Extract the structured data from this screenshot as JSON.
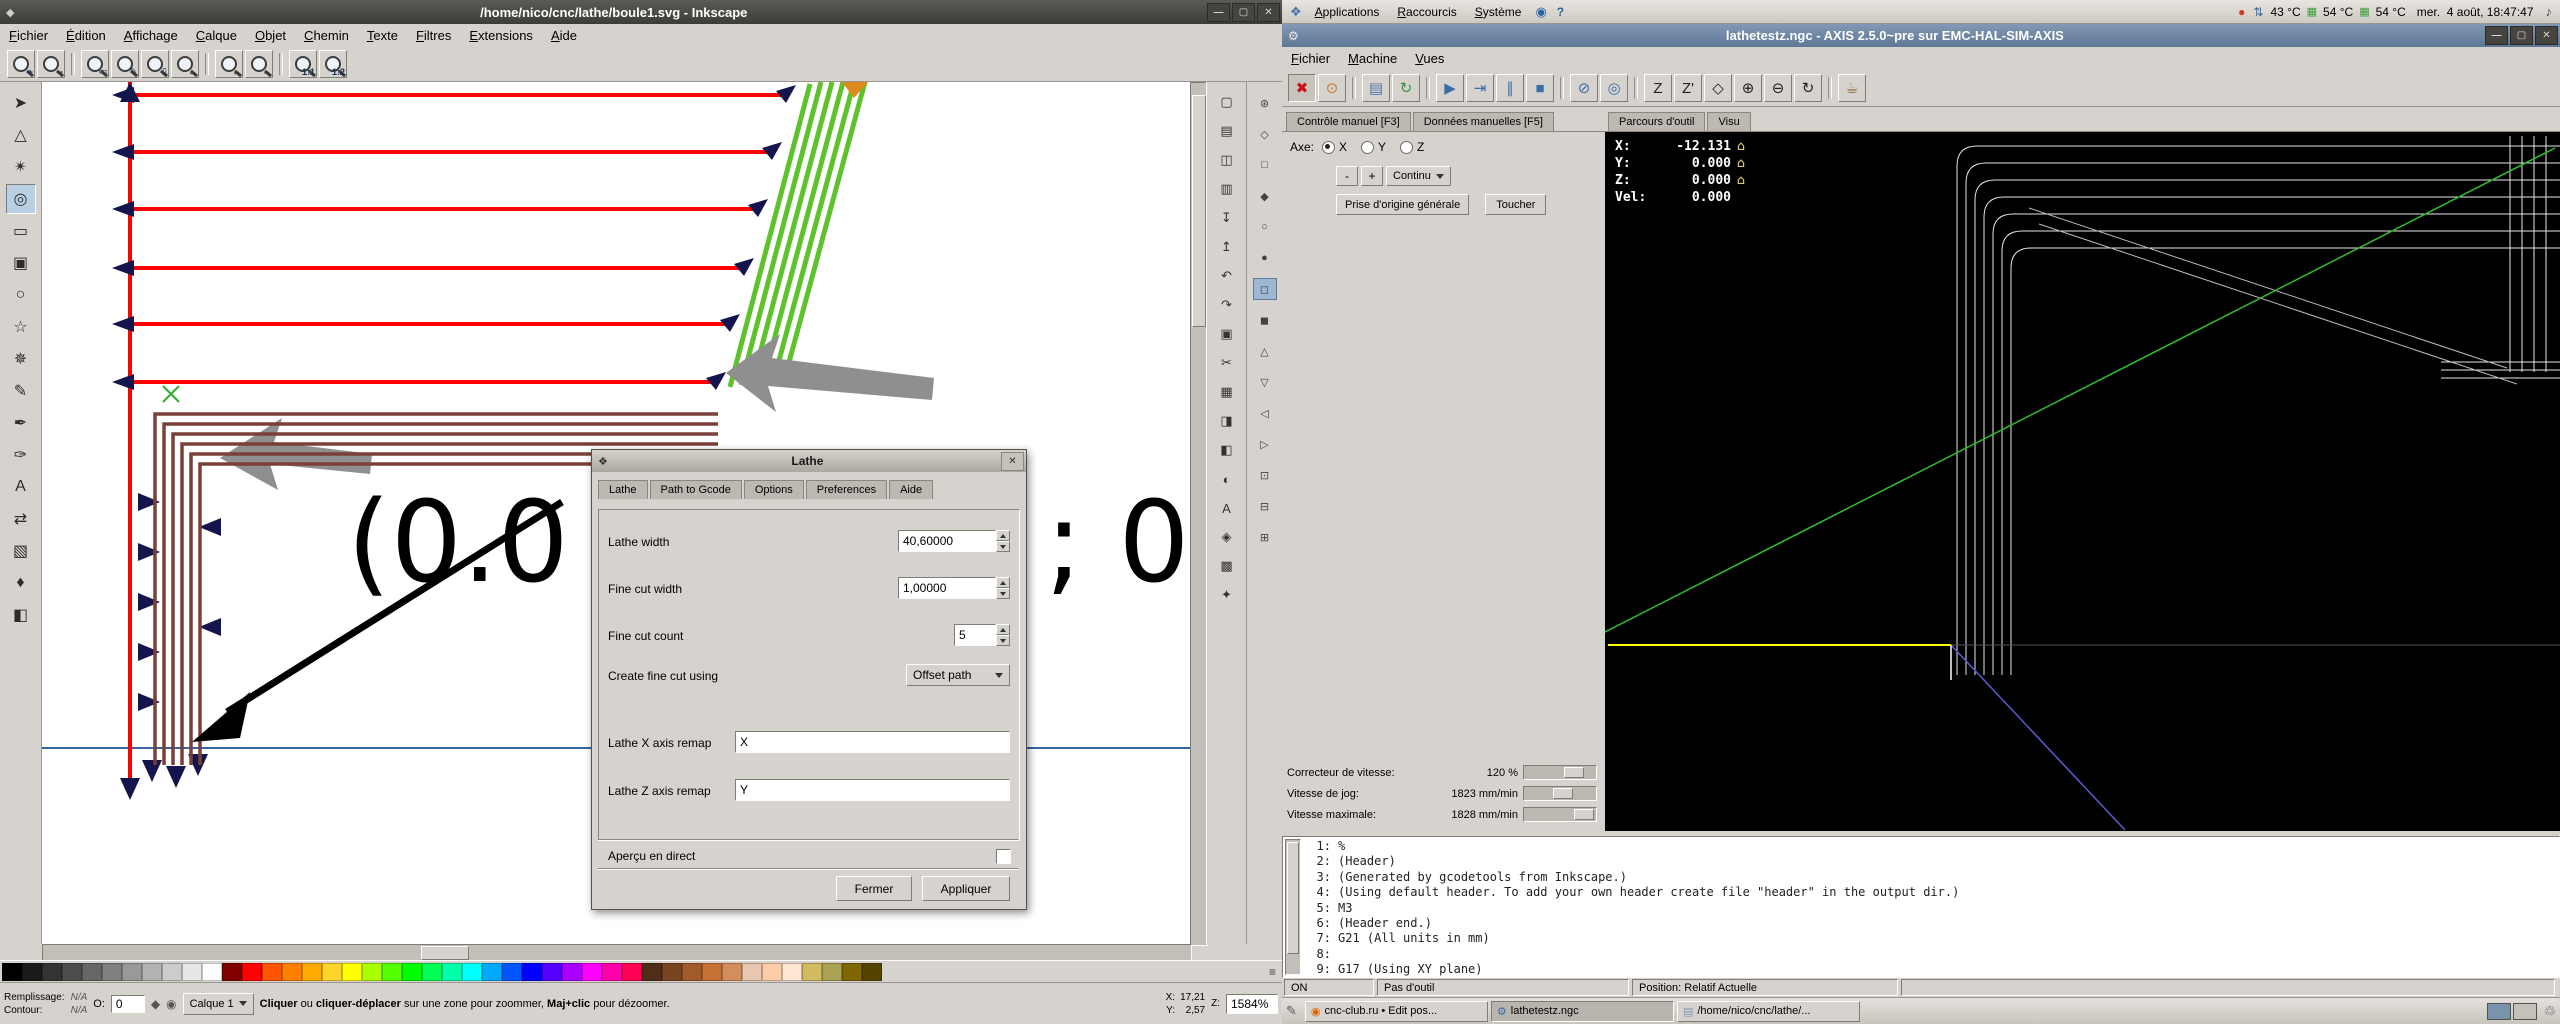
{
  "icons": {
    "app": "◆",
    "gear": "⚙",
    "dialog": "❖",
    "home": "⌂",
    "eye": "◉",
    "lock": "◆",
    "volume": "♪",
    "trash": "♲",
    "applet": "✎",
    "browser": "◉",
    "help": "?",
    "applications": "❖",
    "update": "●",
    "network": "⇅",
    "sensor": "▦",
    "min": "—",
    "max": "▢",
    "close": "✕",
    "palette_config": "≡"
  },
  "inkscape": {
    "window_title": "/home/nico/cnc/lathe/boule1.svg - Inkscape",
    "menus": [
      "Fichier",
      "Édition",
      "Affichage",
      "Calque",
      "Objet",
      "Chemin",
      "Texte",
      "Filtres",
      "Extensions",
      "Aide"
    ],
    "zoom_toolbar": {
      "g1": [
        {
          "name": "zoom-in-button",
          "sub": "+"
        },
        {
          "name": "zoom-out-button",
          "sub": "−"
        }
      ],
      "g2": [
        {
          "name": "zoom-selection-button",
          "sub": "▭"
        },
        {
          "name": "zoom-drawing-button",
          "sub": "✎"
        },
        {
          "name": "zoom-page-button",
          "sub": "▯"
        },
        {
          "name": "zoom-page-width-button",
          "sub": "↔"
        }
      ],
      "g3": [
        {
          "name": "zoom-previous-button",
          "sub": "←"
        },
        {
          "name": "zoom-next-button",
          "sub": "→"
        }
      ],
      "g4": [
        {
          "name": "zoom-1-1-button",
          "sub": "1:1"
        },
        {
          "name": "zoom-1-2-button",
          "sub": "1:2"
        }
      ]
    },
    "toolbox": [
      {
        "name": "selector-tool",
        "glyph": "➤"
      },
      {
        "name": "node-tool",
        "glyph": "△"
      },
      {
        "name": "tweak-tool",
        "glyph": "✴"
      },
      {
        "name": "zoom-tool",
        "glyph": "◎",
        "active": "true"
      },
      {
        "name": "rectangle-tool",
        "glyph": "▭"
      },
      {
        "name": "box-3d-tool",
        "glyph": "▣"
      },
      {
        "name": "ellipse-tool",
        "glyph": "○"
      },
      {
        "name": "star-tool",
        "glyph": "☆"
      },
      {
        "name": "spiral-tool",
        "glyph": "✵"
      },
      {
        "name": "pencil-tool",
        "glyph": "✎"
      },
      {
        "name": "pen-tool",
        "glyph": "✒"
      },
      {
        "name": "calligraphy-tool",
        "glyph": "✑"
      },
      {
        "name": "text-tool",
        "glyph": "A"
      },
      {
        "name": "connector-tool",
        "glyph": "⇄"
      },
      {
        "name": "gradient-tool",
        "glyph": "▧"
      },
      {
        "name": "dropper-tool",
        "glyph": "♦"
      },
      {
        "name": "paint-bucket-tool",
        "glyph": "◧"
      }
    ],
    "commands_bar": [
      {
        "name": "new-document-button",
        "glyph": "▢"
      },
      {
        "name": "open-file-button",
        "glyph": "▤"
      },
      {
        "name": "save-button",
        "glyph": "◫"
      },
      {
        "name": "print-button",
        "glyph": "▥"
      },
      {
        "name": "import-button",
        "glyph": "↧"
      },
      {
        "name": "export-button",
        "glyph": "↥"
      },
      {
        "name": "undo-button",
        "glyph": "↶"
      },
      {
        "name": "redo-button",
        "glyph": "↷"
      },
      {
        "name": "copy-button",
        "glyph": "▣"
      },
      {
        "name": "cut-button",
        "glyph": "✂"
      },
      {
        "name": "paste-button",
        "glyph": "▦"
      },
      {
        "name": "duplicate-button",
        "glyph": "◨"
      },
      {
        "name": "clone-button",
        "glyph": "◧"
      },
      {
        "name": "fill-stroke-dialog-button",
        "glyph": "◐"
      },
      {
        "name": "text-dialog-button",
        "glyph": "A"
      },
      {
        "name": "xml-editor-button",
        "glyph": "◈"
      },
      {
        "name": "align-dialog-button",
        "glyph": "▩"
      },
      {
        "name": "preferences-button",
        "glyph": "✦"
      }
    ],
    "snap_bar": [
      {
        "name": "enable-snapping-button",
        "glyph": "⊛"
      },
      {
        "name": "snap-bbox-button",
        "glyph": "◇"
      },
      {
        "name": "snap-bbox-edges-button",
        "glyph": "□"
      },
      {
        "name": "snap-bbox-corners-button",
        "glyph": "◆"
      },
      {
        "name": "snap-nodes-button",
        "glyph": "○"
      },
      {
        "name": "snap-paths-button",
        "glyph": "●"
      },
      {
        "name": "snap-path-intersections-button",
        "glyph": "◻",
        "active": "true"
      },
      {
        "name": "snap-cusp-nodes-button",
        "glyph": "◼"
      },
      {
        "name": "snap-smooth-nodes-button",
        "glyph": "△"
      },
      {
        "name": "snap-midpoints-button",
        "glyph": "▽"
      },
      {
        "name": "snap-centers-button",
        "glyph": "◁"
      },
      {
        "name": "snap-grid-button",
        "glyph": "▷"
      },
      {
        "name": "snap-guides-button",
        "glyph": "⊡"
      },
      {
        "name": "snap-page-border-button",
        "glyph": "⊟"
      },
      {
        "name": "snap-rotation-center-button",
        "glyph": "⊞"
      }
    ],
    "palette": [
      "#000000",
      "#1a1a1a",
      "#333333",
      "#4d4d4d",
      "#666666",
      "#808080",
      "#999999",
      "#b3b3b3",
      "#cccccc",
      "#e6e6e6",
      "#ffffff",
      "#800000",
      "#ff0000",
      "#ff5500",
      "#ff8000",
      "#ffaa00",
      "#ffd42a",
      "#ffff00",
      "#aaff00",
      "#55ff00",
      "#00ff00",
      "#00ff55",
      "#00ffaa",
      "#00ffff",
      "#00aaff",
      "#0055ff",
      "#0000ff",
      "#5500ff",
      "#aa00ff",
      "#ff00ff",
      "#ff00aa",
      "#ff0055",
      "#502d16",
      "#784421",
      "#a05a2c",
      "#c87137",
      "#d38d5f",
      "#e9c6af",
      "#ffccaa",
      "#ffe6d5",
      "#d3bc5f",
      "#aaa152",
      "#806600",
      "#554400"
    ],
    "canvas_text_left": "(0.0",
    "canvas_text_right": "; 0",
    "statusbar": {
      "fill_label": "Remplissage:",
      "fill_value": "N/A",
      "stroke_label": "Contour:",
      "stroke_value": "N/A",
      "opacity_label": "O:",
      "opacity_value": "0",
      "layer_name": "Calque 1",
      "msg_b1": "Cliquer",
      "msg_1": " ou ",
      "msg_b2": "cliquer-déplacer",
      "msg_2": " sur une zone pour zoommer, ",
      "msg_b3": "Maj+clic",
      "msg_3": " pour dézoomer.",
      "x_label": "X:",
      "x_value": "17,21",
      "y_label": "Y:",
      "y_value": "2,57",
      "z_label": "Z:",
      "zoom_value": "1584%"
    }
  },
  "lathe_dialog": {
    "title": "Lathe",
    "tabs": [
      "Lathe",
      "Path to Gcode",
      "Options",
      "Preferences",
      "Aide"
    ],
    "fields": {
      "lathe_width": {
        "label": "Lathe width",
        "value": "40,60000"
      },
      "fine_cut_width": {
        "label": "Fine cut width",
        "value": "1,00000"
      },
      "fine_cut_count": {
        "label": "Fine cut count",
        "value": "5"
      },
      "create_fine_cut_using": {
        "label": "Create fine cut using",
        "value": "Offset path"
      },
      "x_remap": {
        "label": "Lathe X axis remap",
        "value": "X"
      },
      "z_remap": {
        "label": "Lathe Z axis remap",
        "value": "Y"
      }
    },
    "live_preview_label": "Aperçu en direct",
    "buttons": {
      "close": "Fermer",
      "apply": "Appliquer"
    }
  },
  "panel": {
    "menus": [
      "Applications",
      "Raccourcis",
      "Système"
    ],
    "temp1": "43 °C",
    "temp2": "54 °C",
    "temp3": "54 °C",
    "clock": "mer.  4 août, 18:47:47"
  },
  "axis": {
    "window_title": "lathetestz.ngc - AXIS 2.5.0~pre sur EMC-HAL-SIM-AXIS",
    "menus": [
      "Fichier",
      "Machine",
      "Vues"
    ],
    "toolbar": {
      "g1": [
        {
          "name": "estop-button",
          "glyph": "✖",
          "fg": "#cc1111",
          "active": "true"
        },
        {
          "name": "machine-power-button",
          "glyph": "⊙",
          "fg": "#c87a2e"
        }
      ],
      "g2": [
        {
          "name": "open-file-button",
          "glyph": "▤",
          "fg": "#4a76a8"
        },
        {
          "name": "reload-button",
          "glyph": "↻",
          "fg": "#3f8f3f"
        }
      ],
      "g3": [
        {
          "name": "run-button",
          "glyph": "▶",
          "fg": "#3a6ea5"
        },
        {
          "name": "step-button",
          "glyph": "⇥",
          "fg": "#3a6ea5"
        },
        {
          "name": "pause-button",
          "glyph": "∥",
          "fg": "#3a6ea5"
        },
        {
          "name": "stop-button",
          "glyph": "■",
          "fg": "#3a6ea5"
        }
      ],
      "g4": [
        {
          "name": "skip-lines-button",
          "glyph": "⊘",
          "fg": "#3a6ea5"
        },
        {
          "name": "optional-stop-button",
          "glyph": "◎",
          "fg": "#3a6ea5"
        }
      ],
      "g5": [
        {
          "name": "view-z-button",
          "glyph": "Z",
          "fg": "#222222"
        },
        {
          "name": "view-z-rotated-button",
          "glyph": "Z'",
          "fg": "#222222"
        },
        {
          "name": "view-perspective-button",
          "glyph": "◇",
          "fg": "#222222"
        },
        {
          "name": "zoom-in-button",
          "glyph": "⊕",
          "fg": "#222222"
        },
        {
          "name": "zoom-out-button",
          "glyph": "⊖",
          "fg": "#222222"
        },
        {
          "name": "rotate-view-button",
          "glyph": "↻",
          "fg": "#222222"
        }
      ],
      "g6": [
        {
          "name": "clear-plot-button",
          "glyph": "☕",
          "fg": "#8a6d3b"
        }
      ]
    },
    "tabs_left": [
      "Contrôle manuel [F3]",
      "Données manuelles [F5]"
    ],
    "tabs_right": [
      "Parcours d'outil",
      "Visu"
    ],
    "manual": {
      "axis_label": "Axe:",
      "axes": [
        {
          "label": "X",
          "selected": "true"
        },
        {
          "label": "Y"
        },
        {
          "label": "Z"
        }
      ],
      "jog_minus": "-",
      "jog_plus": "+",
      "jog_mode": "Continu",
      "home_all": "Prise d'origine générale",
      "touch_off": "Toucher"
    },
    "dro": [
      {
        "label": "X:",
        "value": "-12.131",
        "homed": "true"
      },
      {
        "label": "Y:",
        "value": "0.000",
        "homed": "true"
      },
      {
        "label": "Z:",
        "value": "0.000",
        "homed": "true"
      },
      {
        "label": "Vel:",
        "value": "0.000"
      }
    ],
    "sliders": [
      {
        "label": "Correcteur de vitesse:",
        "value": "120 %",
        "pct": "55%"
      },
      {
        "label": "Vitesse de jog:",
        "value": "1823 mm/min",
        "pct": "40%"
      },
      {
        "label": "Vitesse maximale:",
        "value": "1828 mm/min",
        "pct": "70%"
      }
    ],
    "gcode": [
      {
        "n": "1:",
        "text": "%"
      },
      {
        "n": "2:",
        "text": "(Header)"
      },
      {
        "n": "3:",
        "text": "(Generated by gcodetools from Inkscape.)"
      },
      {
        "n": "4:",
        "text": "(Using default header. To add your own header create file \"header\" in the output dir.)"
      },
      {
        "n": "5:",
        "text": "M3"
      },
      {
        "n": "6:",
        "text": "(Header end.)"
      },
      {
        "n": "7:",
        "text": "G21 (All units in mm)"
      },
      {
        "n": "8:",
        "text": ""
      },
      {
        "n": "9:",
        "text": "G17 (Using XY plane)"
      }
    ],
    "status": {
      "power": "ON",
      "tool": "Pas d'outil",
      "position": "Position: Relatif Actuelle"
    }
  },
  "taskbar": {
    "windows": [
      {
        "name": "task-browser-button",
        "label": "cnc-club.ru • Edit pos...",
        "glyph": "◉",
        "fg": "#e66000"
      },
      {
        "name": "task-axis-button",
        "label": "lathetestz.ngc",
        "glyph": "⚙",
        "fg": "#3a6ea5",
        "active": "true"
      },
      {
        "name": "task-files-button",
        "label": "/home/nico/cnc/lathe/...",
        "glyph": "▤",
        "fg": "#7d97b8"
      }
    ]
  }
}
